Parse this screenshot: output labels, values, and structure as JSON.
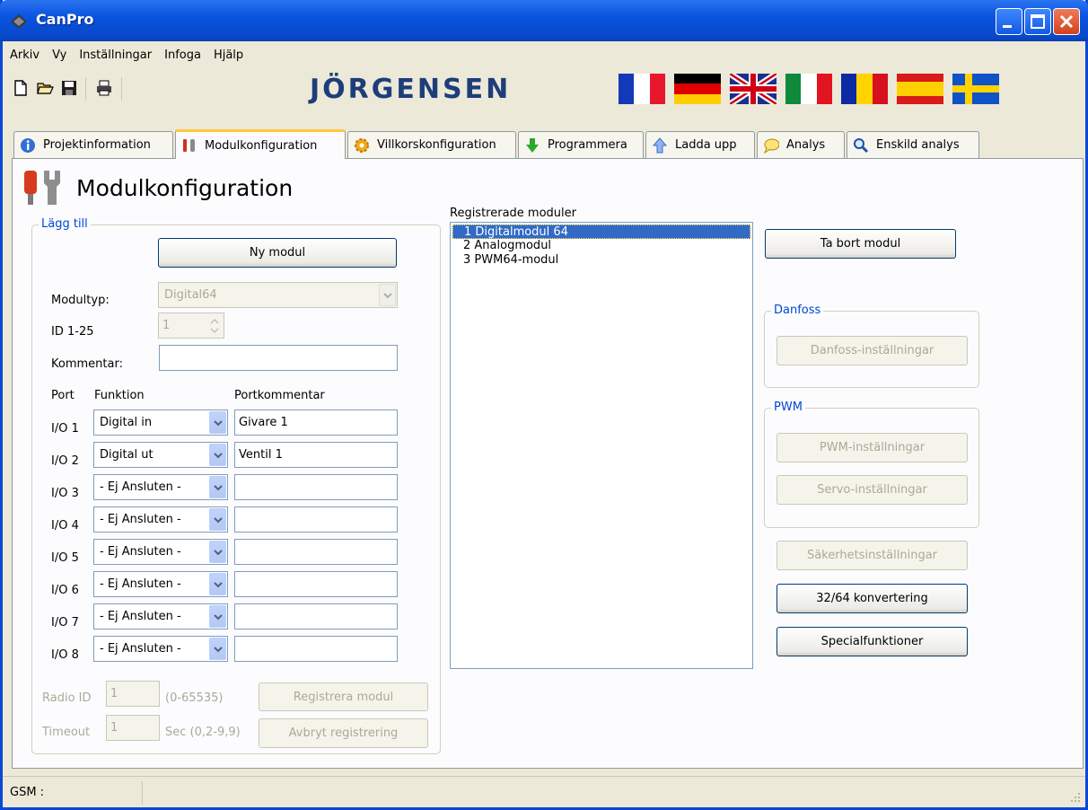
{
  "window": {
    "title": "CanPro"
  },
  "menu": [
    "Arkiv",
    "Vy",
    "Inställningar",
    "Infoga",
    "Hjälp"
  ],
  "toolbar": {
    "icons": [
      "new-file-icon",
      "open-folder-icon",
      "save-icon",
      "print-icon"
    ],
    "brand": "JÖRGENSEN",
    "flags": [
      "france-flag-icon",
      "germany-flag-icon",
      "uk-flag-icon",
      "italy-flag-icon",
      "romania-flag-icon",
      "spain-flag-icon",
      "sweden-flag-icon"
    ]
  },
  "tabs": [
    {
      "label": "Projektinformation",
      "icon": "info-icon"
    },
    {
      "label": "Modulkonfiguration",
      "icon": "wrench-icon",
      "active": true
    },
    {
      "label": "Villkorskonfiguration",
      "icon": "gear-icon"
    },
    {
      "label": "Programmera",
      "icon": "download-arrow-icon"
    },
    {
      "label": "Ladda upp",
      "icon": "upload-arrow-icon"
    },
    {
      "label": "Analys",
      "icon": "speech-bubble-icon"
    },
    {
      "label": "Enskild analys",
      "icon": "magnifier-icon"
    }
  ],
  "page": {
    "title": "Modulkonfiguration",
    "add_group": "Lägg till",
    "new_module": "Ny modul",
    "module_type_label": "Modultyp:",
    "module_type_value": "Digital64",
    "id_label": "ID 1-25",
    "id_value": "1",
    "comment_label": "Kommentar:",
    "comment_value": "",
    "col_port": "Port",
    "col_function": "Funktion",
    "col_comment": "Portkommentar",
    "ports": [
      {
        "port": "I/O 1",
        "function": "Digital in",
        "comment": "Givare 1"
      },
      {
        "port": "I/O 2",
        "function": "Digital ut",
        "comment": "Ventil 1"
      },
      {
        "port": "I/O 3",
        "function": "- Ej Ansluten -",
        "comment": ""
      },
      {
        "port": "I/O 4",
        "function": "- Ej Ansluten -",
        "comment": ""
      },
      {
        "port": "I/O 5",
        "function": "- Ej Ansluten -",
        "comment": ""
      },
      {
        "port": "I/O 6",
        "function": "- Ej Ansluten -",
        "comment": ""
      },
      {
        "port": "I/O 7",
        "function": "- Ej Ansluten -",
        "comment": ""
      },
      {
        "port": "I/O 8",
        "function": "- Ej Ansluten -",
        "comment": ""
      }
    ],
    "radio_id_label": "Radio ID",
    "radio_id_value": "1",
    "radio_id_range": "(0-65535)",
    "register_module": "Registrera modul",
    "timeout_label": "Timeout",
    "timeout_value": "1",
    "timeout_range": "Sec (0,2-9,9)",
    "cancel_registration": "Avbryt registrering",
    "registered_label": "Registrerade moduler",
    "registered": [
      "1  Digitalmodul 64",
      "2  Analogmodul",
      "3  PWM64-modul"
    ],
    "remove_module": "Ta bort modul",
    "danfoss_group": "Danfoss",
    "danfoss_settings": "Danfoss-inställningar",
    "pwm_group": "PWM",
    "pwm_settings": "PWM-inställningar",
    "servo_settings": "Servo-inställningar",
    "safety_settings": "Säkerhetsinställningar",
    "convert_3264": "32/64 konvertering",
    "special_functions": "Specialfunktioner"
  },
  "status": {
    "gsm": "GSM :"
  }
}
